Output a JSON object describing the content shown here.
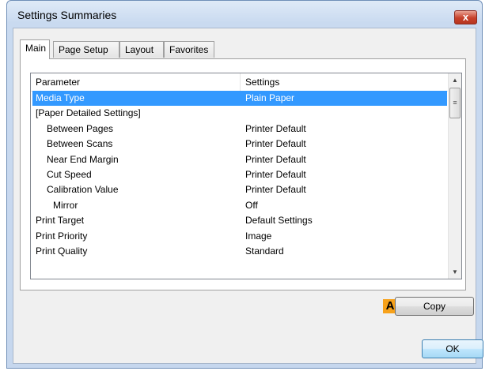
{
  "window": {
    "title": "Settings Summaries",
    "close_glyph": "x"
  },
  "tabs": [
    {
      "label": "Main",
      "active": true
    },
    {
      "label": "Page Setup",
      "active": false
    },
    {
      "label": "Layout",
      "active": false
    },
    {
      "label": "Favorites",
      "active": false
    }
  ],
  "table": {
    "headers": {
      "parameter": "Parameter",
      "settings": "Settings"
    },
    "rows": [
      {
        "parameter": "Media Type",
        "settings": "Plain Paper"
      },
      {
        "parameter": "[Paper Detailed Settings]",
        "settings": ""
      },
      {
        "parameter": "Between Pages",
        "settings": "Printer Default"
      },
      {
        "parameter": "Between Scans",
        "settings": "Printer Default"
      },
      {
        "parameter": "Near End Margin",
        "settings": "Printer Default"
      },
      {
        "parameter": "Cut Speed",
        "settings": "Printer Default"
      },
      {
        "parameter": "Calibration Value",
        "settings": "Printer Default"
      },
      {
        "parameter": "Mirror",
        "settings": "Off"
      },
      {
        "parameter": "Print Target",
        "settings": "Default Settings"
      },
      {
        "parameter": "Print Priority",
        "settings": "Image"
      },
      {
        "parameter": "Print Quality",
        "settings": "Standard"
      }
    ],
    "selected_row": "Media Type"
  },
  "scrollbar": {
    "up_glyph": "▲",
    "down_glyph": "▼",
    "thumb_glyph": "≡"
  },
  "annotation": {
    "label": "A",
    "color": "#f7a21b"
  },
  "buttons": {
    "copy": "Copy",
    "ok": "OK"
  },
  "colors": {
    "selection": "#3399ff",
    "title_gradient": "#c9daf0",
    "close_button": "#c7412b"
  }
}
